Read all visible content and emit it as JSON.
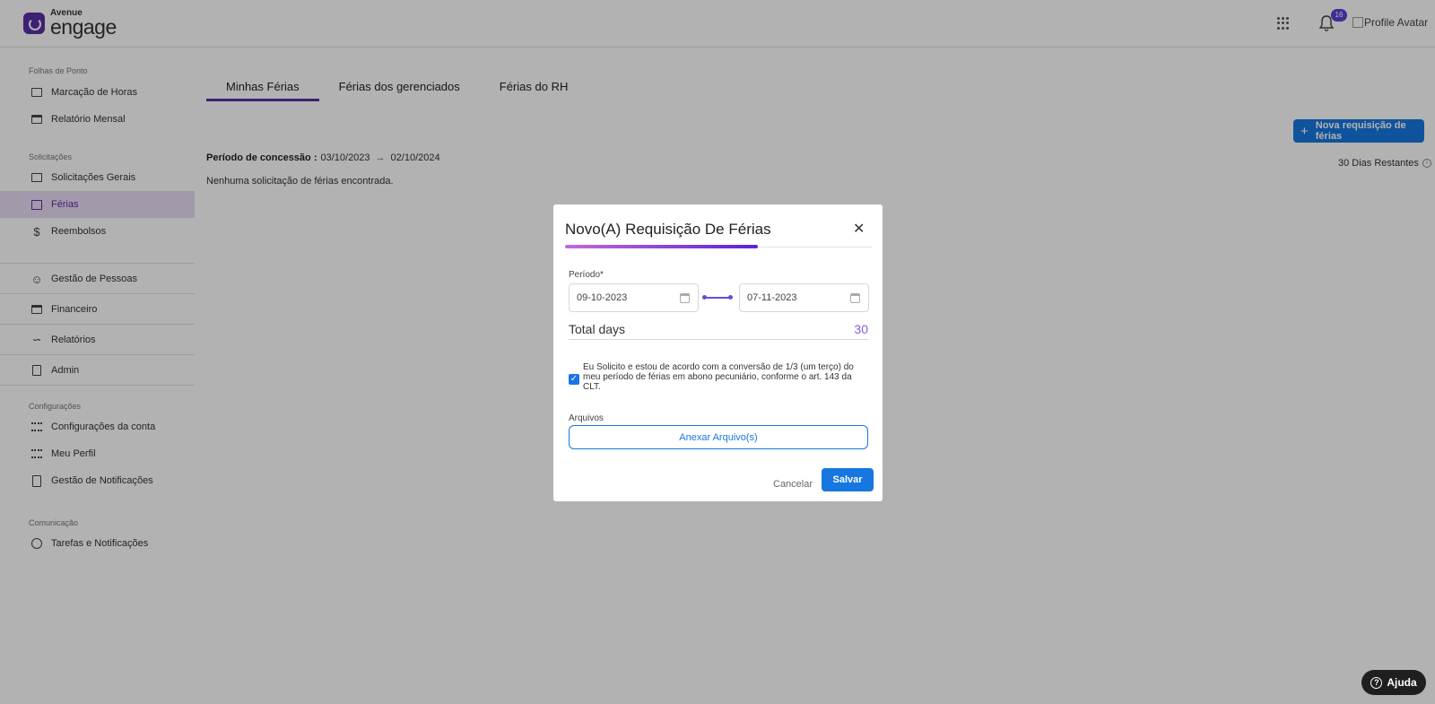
{
  "header": {
    "logo_small": "Avenue",
    "logo_big": "engage",
    "notification_count": "16",
    "avatar_alt": "Profile Avatar"
  },
  "sidebar": {
    "sections": [
      "Folhas de Ponto",
      "Solicitações",
      "Configurações",
      "Comunicação"
    ],
    "items": [
      {
        "label": "Marcação de Horas",
        "icon": "time-sheet-icon"
      },
      {
        "label": "Relatório Mensal",
        "icon": "calendar-icon"
      },
      {
        "label": "Solicitações Gerais",
        "icon": "requests-icon"
      },
      {
        "label": "Férias",
        "icon": "suitcase-icon"
      },
      {
        "label": "Reembolsos",
        "icon": "dollar-icon"
      },
      {
        "label": "Gestão de Pessoas",
        "icon": "people-icon"
      },
      {
        "label": "Financeiro",
        "icon": "card-icon"
      },
      {
        "label": "Relatórios",
        "icon": "chart-icon"
      },
      {
        "label": "Admin",
        "icon": "documents-icon"
      },
      {
        "label": "Configurações da conta",
        "icon": "list-icon"
      },
      {
        "label": "Meu Perfil",
        "icon": "list-icon"
      },
      {
        "label": "Gestão de Notificações",
        "icon": "file-icon"
      },
      {
        "label": "Tarefas e Notificações",
        "icon": "info-icon"
      }
    ]
  },
  "main": {
    "tabs": [
      "Minhas Férias",
      "Férias dos gerenciados",
      "Férias do RH"
    ],
    "periodo_label": "Período de concessão :",
    "periodo_start": "03/10/2023",
    "periodo_end": "02/10/2024",
    "empty_text": "Nenhuma solicitação de férias encontrada.",
    "new_button": "Nova requisição de férias",
    "days_remaining": "30 Dias Restantes"
  },
  "modal": {
    "title": "Novo(A) Requisição De Férias",
    "periodo_label": "Período*",
    "date_start": "09-10-2023",
    "date_end": "07-11-2023",
    "total_label": "Total days",
    "total_value": "30",
    "checkbox_checked": true,
    "checkbox_text": "Eu Solicito e estou de acordo com a conversão de 1/3 (um terço) do meu período de férias em abono pecuniário, conforme o art. 143 da CLT.",
    "files_label": "Arquivos",
    "attach_button": "Anexar Arquivo(s)",
    "cancel_button": "Cancelar",
    "save_button": "Salvar"
  },
  "help_button": "Ajuda",
  "colors": {
    "accent": "#5b2ea6",
    "primary_button": "#1677e0",
    "active_bg": "#e9dcf4"
  }
}
